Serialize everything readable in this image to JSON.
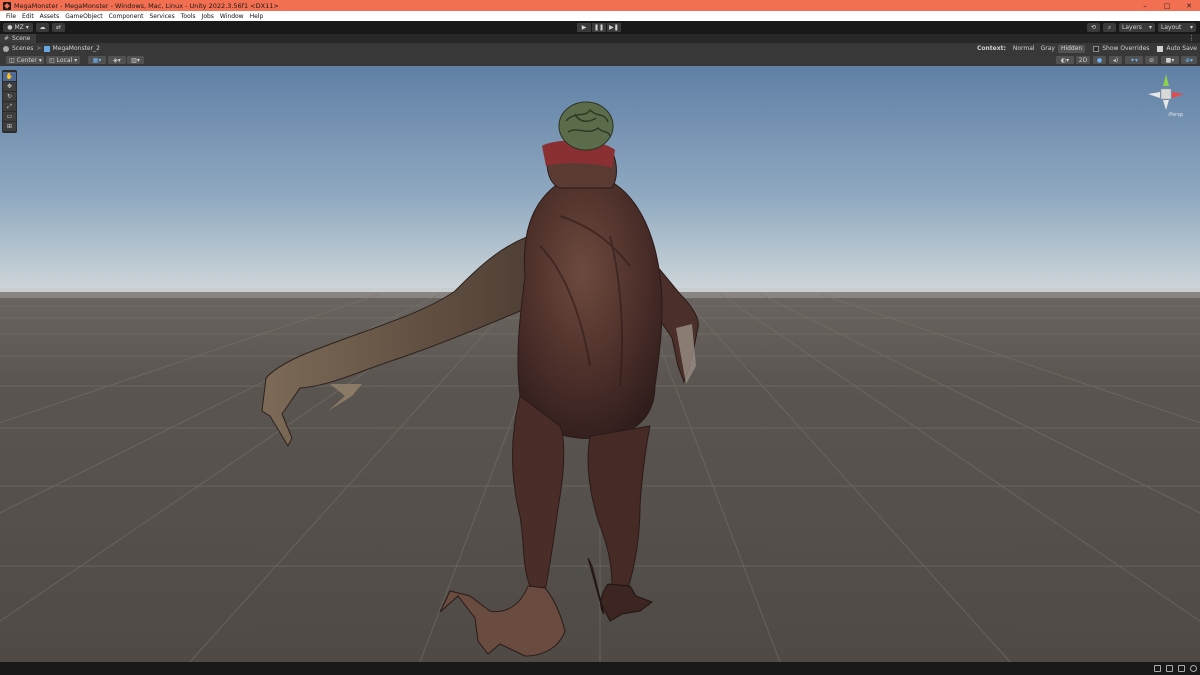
{
  "window": {
    "title": "MegaMonster - MegaMonster - Windows, Mac, Linux - Unity 2022.3.56f1 <DX11>",
    "controls": {
      "minimize": "–",
      "maximize": "□",
      "close": "✕"
    }
  },
  "menu": [
    "File",
    "Edit",
    "Assets",
    "GameObject",
    "Component",
    "Services",
    "Tools",
    "Jobs",
    "Window",
    "Help"
  ],
  "toolbar": {
    "account": "MZ",
    "play": "▶",
    "pause": "❚❚",
    "step": "▶❚",
    "layers": "Layers",
    "layout": "Layout"
  },
  "tab": {
    "label": "Scene",
    "more": "⋮"
  },
  "breadcrumb": {
    "root": "Scenes",
    "separator": ">",
    "current": "MegaMonster_2"
  },
  "context": {
    "label": "Context:",
    "options": [
      "Normal",
      "Gray",
      "Hidden"
    ],
    "active": "Hidden",
    "show_overrides": "Show Overrides",
    "auto_save": "Auto Save"
  },
  "scene_toolbar": {
    "pivot": "Center",
    "space": "Local",
    "mode_2d": "2D"
  },
  "gizmo": {
    "label": "‹Persp"
  },
  "colors": {
    "title_bar": "#f36f52",
    "sky_top": "#6887ab",
    "sky_horizon": "#d4dadb",
    "ground": "#58534f",
    "active_tool": "#4d6b94"
  }
}
